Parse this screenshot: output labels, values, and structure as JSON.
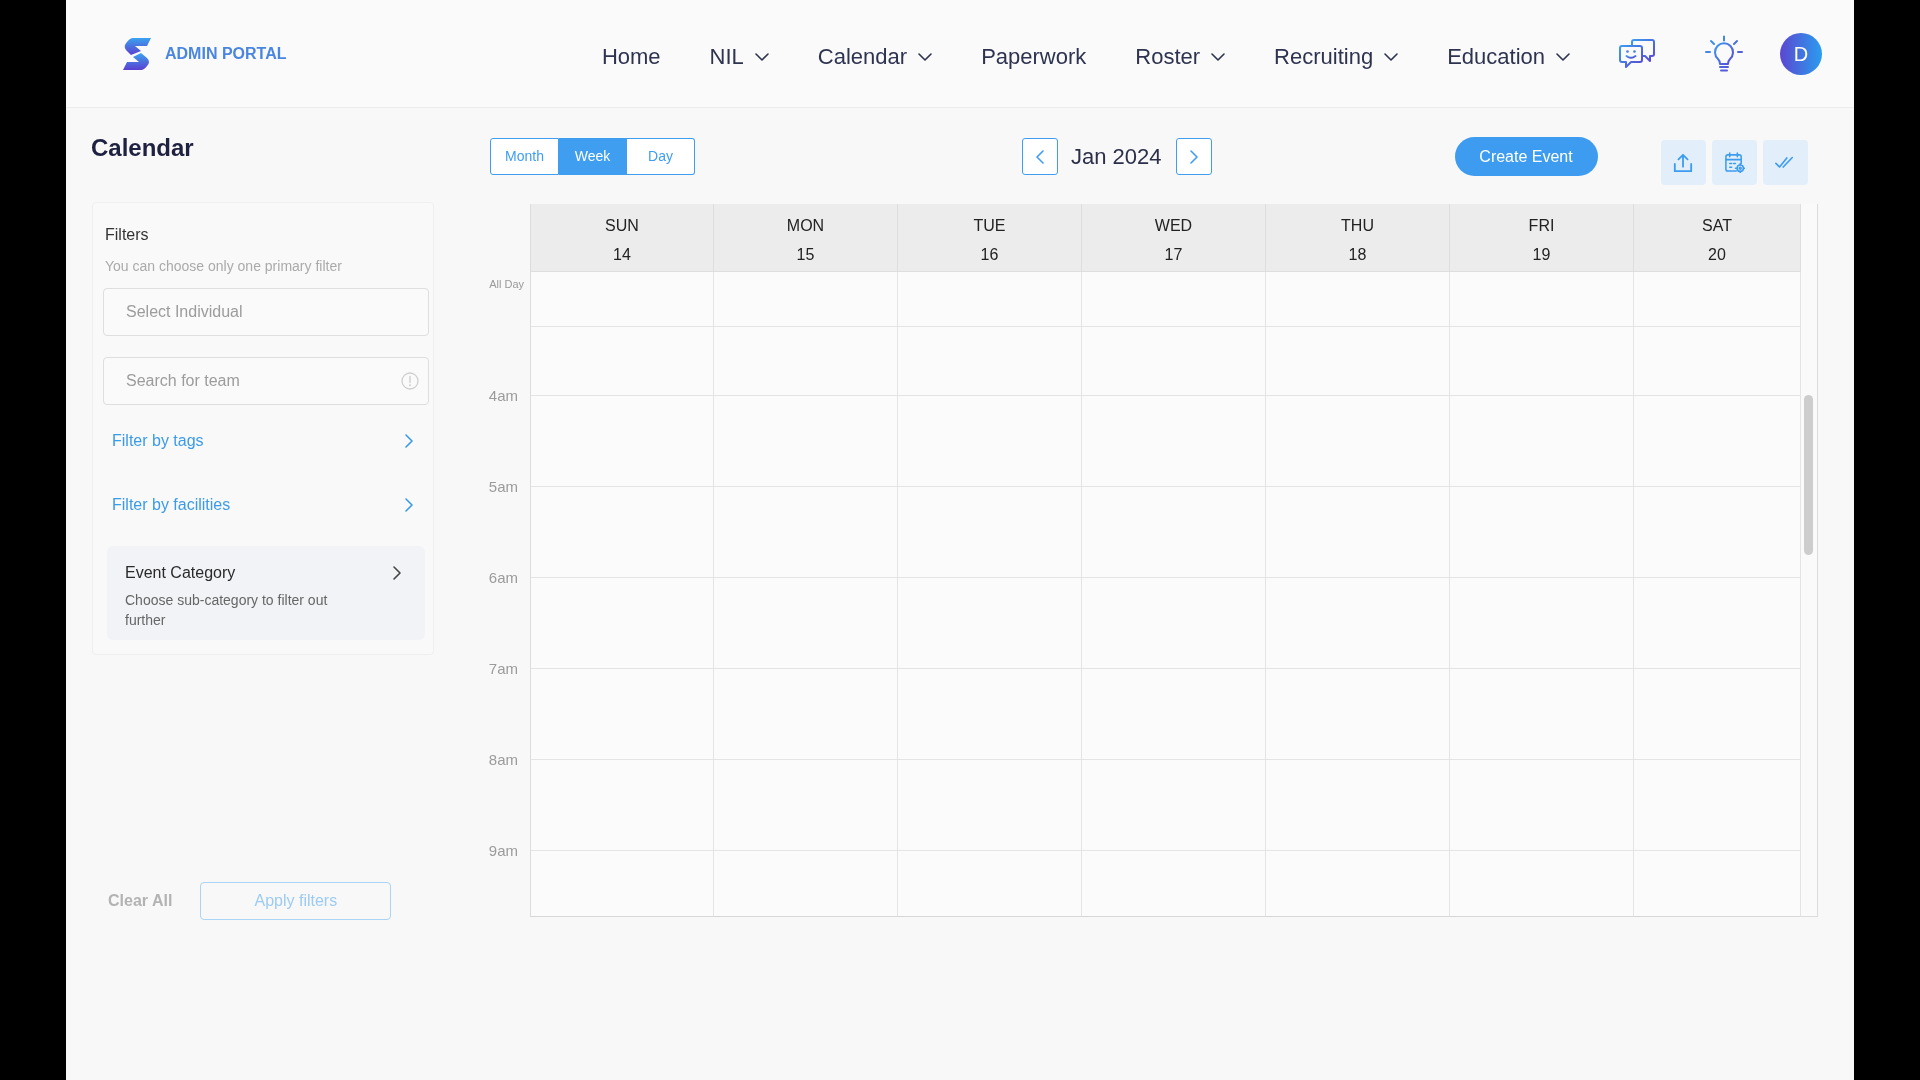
{
  "brand": {
    "name": "ADMIN PORTAL"
  },
  "nav": {
    "items": [
      {
        "label": "Home",
        "has_menu": false
      },
      {
        "label": "NIL",
        "has_menu": true
      },
      {
        "label": "Calendar",
        "has_menu": true
      },
      {
        "label": "Paperwork",
        "has_menu": false
      },
      {
        "label": "Roster",
        "has_menu": true
      },
      {
        "label": "Recruiting",
        "has_menu": true
      },
      {
        "label": "Education",
        "has_menu": true
      }
    ],
    "avatar": {
      "initial": "D"
    }
  },
  "page": {
    "title": "Calendar"
  },
  "filters": {
    "title": "Filters",
    "hint": "You can choose only one primary filter",
    "fields": [
      {
        "kind": "select",
        "placeholder": "Select Individual"
      },
      {
        "kind": "search",
        "placeholder": "Search for team"
      }
    ],
    "links": [
      {
        "label": "Filter by tags"
      },
      {
        "label": "Filter by facilities"
      }
    ],
    "category": {
      "title": "Event Category",
      "description": "Choose sub-category to filter out further"
    },
    "actions": [
      {
        "kind": "link",
        "label": "Clear All",
        "disabled": true
      },
      {
        "kind": "outline",
        "label": "Apply filters",
        "disabled": true
      }
    ]
  },
  "calendar": {
    "views": [
      {
        "label": "Month",
        "selected": false
      },
      {
        "label": "Week",
        "selected": true
      },
      {
        "label": "Day",
        "selected": false
      }
    ],
    "period": "Jan 2024",
    "create_button": "Create Event",
    "days": [
      {
        "weekday": "SUN",
        "date": "14"
      },
      {
        "weekday": "MON",
        "date": "15"
      },
      {
        "weekday": "TUE",
        "date": "16"
      },
      {
        "weekday": "WED",
        "date": "17"
      },
      {
        "weekday": "THU",
        "date": "18"
      },
      {
        "weekday": "FRI",
        "date": "19"
      },
      {
        "weekday": "SAT",
        "date": "20"
      }
    ],
    "all_day_label": "All Day",
    "hours": [
      "4am",
      "5am",
      "6am",
      "7am",
      "8am",
      "9am"
    ]
  }
}
